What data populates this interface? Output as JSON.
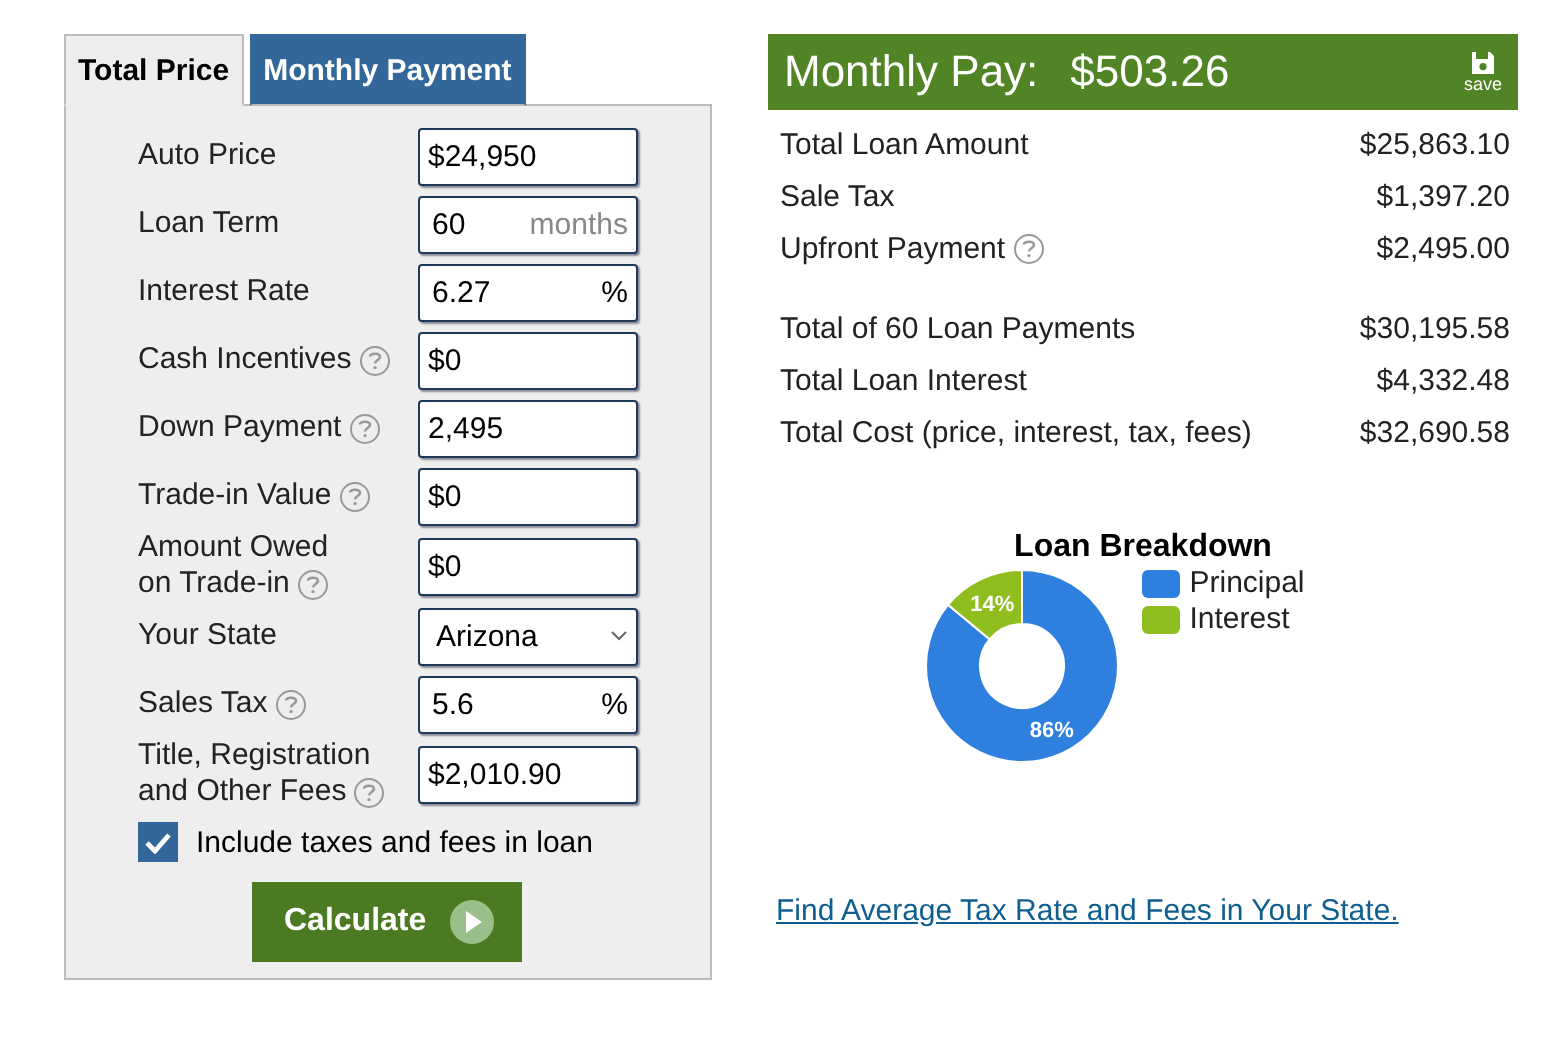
{
  "tabs": [
    {
      "label": "Total Price",
      "selected": true
    },
    {
      "label": "Monthly Payment",
      "selected": false
    }
  ],
  "fields": [
    {
      "label": [
        "Auto Price"
      ],
      "help": false,
      "kind": "text",
      "value": "$24,950"
    },
    {
      "label": [
        "Loan Term"
      ],
      "help": false,
      "kind": "suffix",
      "value": "60",
      "suffix": "months",
      "suffix_muted": true
    },
    {
      "label": [
        "Interest Rate"
      ],
      "help": false,
      "kind": "suffix",
      "value": "6.27",
      "suffix": "%",
      "suffix_muted": false
    },
    {
      "label": [
        "Cash Incentives"
      ],
      "help": true,
      "kind": "text",
      "value": "$0"
    },
    {
      "label": [
        "Down Payment"
      ],
      "help": true,
      "kind": "text",
      "value": "2,495"
    },
    {
      "label": [
        "Trade-in Value"
      ],
      "help": true,
      "kind": "text",
      "value": "$0"
    },
    {
      "label": [
        "Amount Owed",
        "on Trade-in"
      ],
      "help": true,
      "kind": "text",
      "value": "$0"
    },
    {
      "label": [
        "Your State"
      ],
      "help": false,
      "kind": "select",
      "value": "Arizona"
    },
    {
      "label": [
        "Sales Tax"
      ],
      "help": true,
      "kind": "suffix",
      "value": "5.6",
      "suffix": "%",
      "suffix_muted": false
    },
    {
      "label": [
        "Title, Registration",
        "and Other Fees"
      ],
      "help": true,
      "kind": "text",
      "value": "$2,010.90"
    }
  ],
  "include_fees": {
    "label": "Include taxes and fees in loan",
    "checked": true
  },
  "calculate_button": "Calculate",
  "result_header": {
    "label": "Monthly Pay:",
    "amount": "$503.26",
    "save_label": "save"
  },
  "result_groups": [
    [
      {
        "label": "Total Loan Amount",
        "value": "$25,863.10",
        "help": false
      },
      {
        "label": "Sale Tax",
        "value": "$1,397.20",
        "help": false
      },
      {
        "label": "Upfront Payment",
        "value": "$2,495.00",
        "help": true
      }
    ],
    [
      {
        "label": "Total of 60 Loan Payments",
        "value": "$30,195.58",
        "help": false
      },
      {
        "label": "Total Loan Interest",
        "value": "$4,332.48",
        "help": false
      },
      {
        "label": "Total Cost (price, interest, tax, fees)",
        "value": "$32,690.58",
        "help": false
      }
    ]
  ],
  "chart_data": {
    "type": "donut",
    "title": "Loan Breakdown",
    "categories": [
      "Principal",
      "Interest"
    ],
    "values": [
      86,
      14
    ],
    "colors": [
      "#2f80de",
      "#8fbd1e"
    ],
    "value_labels": [
      "86%",
      "14%"
    ],
    "legend": "right"
  },
  "state_link": "Find Average Tax Rate and Fees in Your State."
}
